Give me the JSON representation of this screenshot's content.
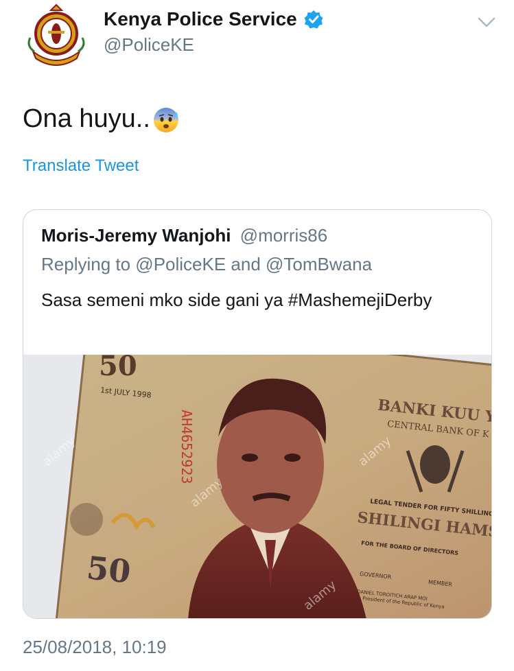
{
  "author": {
    "display_name": "Kenya Police Service",
    "handle": "@PoliceKE",
    "verified": true,
    "avatar_icon": "kenya-police-crest"
  },
  "tweet": {
    "text": "Ona huyu..",
    "emoji": "anxious-face-with-sweat",
    "translate_label": "Translate Tweet",
    "timestamp": "25/08/2018, 10:19"
  },
  "quoted_tweet": {
    "display_name": "Moris-Jeremy Wanjohi",
    "handle": "@morris86",
    "replying_to": "Replying to @PoliceKE and @TomBwana",
    "text": "Sasa semeni mko side gani ya #MashemejiDerby",
    "media": {
      "denomination": "50",
      "date_text": "1st JULY 1998",
      "bank_swahili": "BANKI KUU YA",
      "bank_english": "CENTRAL BANK OF K",
      "legal_tender": "LEGAL TENDER FOR FIFTY SHILLINGS",
      "shillingi": "SHILINGI HAMSIN",
      "board": "FOR THE BOARD OF DIRECTORS",
      "governor": "GOVERNOR",
      "member": "MEMBER",
      "president_name": "DANIEL TOROITICH ARAP MOI",
      "president_title": "President of the Republic of Kenya",
      "watermark": "alamy"
    }
  },
  "colors": {
    "link": "#1b95e0",
    "secondary_text": "#657786",
    "verified_badge": "#1da1f2",
    "border": "#ccd6dd"
  }
}
